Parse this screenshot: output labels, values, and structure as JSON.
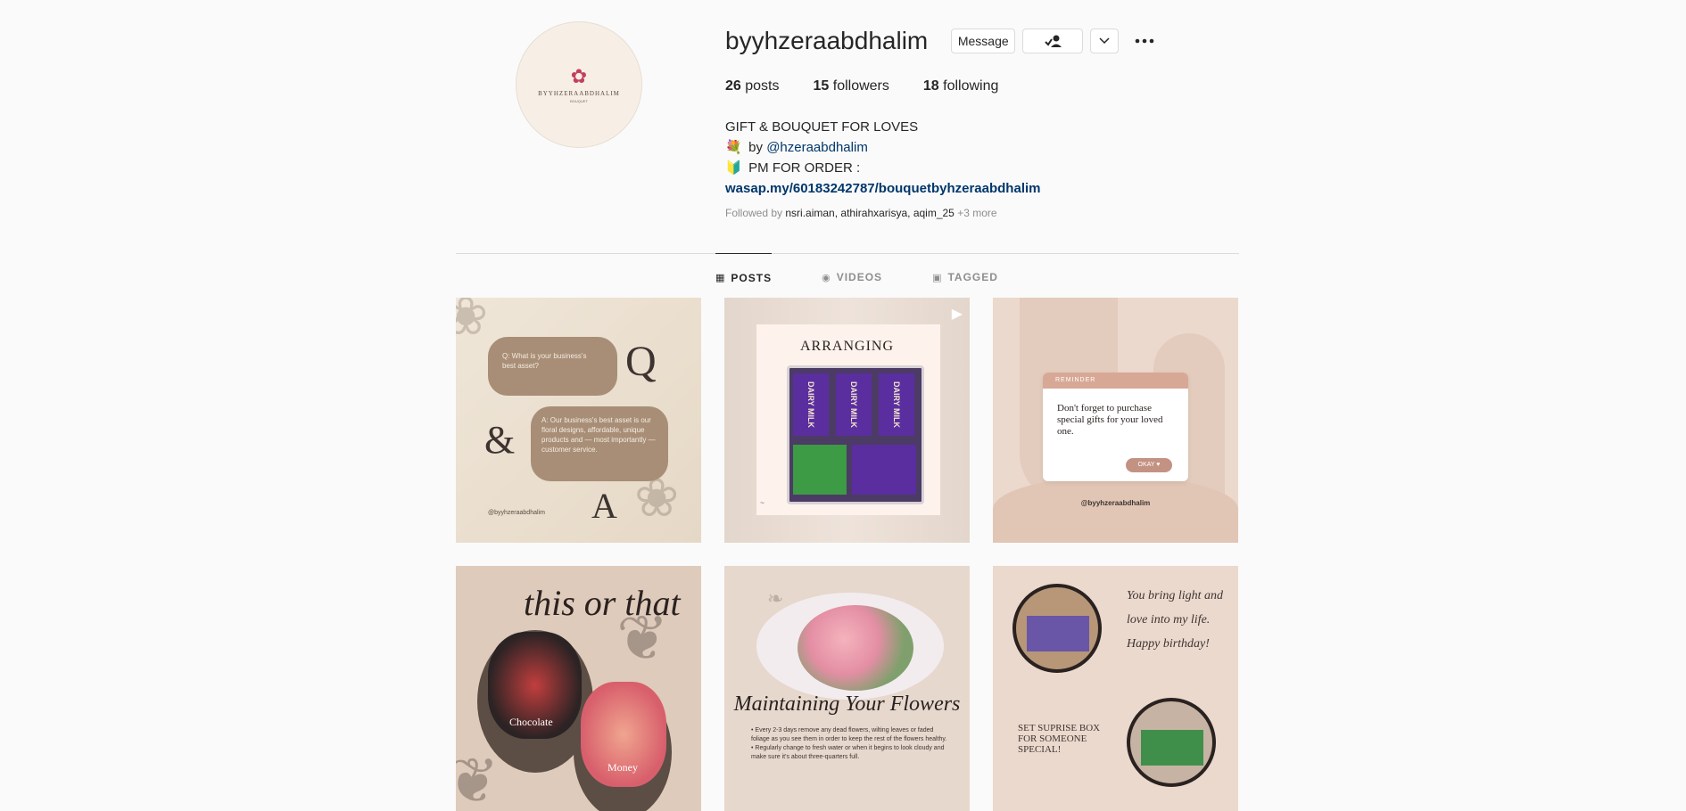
{
  "profile": {
    "username": "byyhzeraabdhalim",
    "avatar_name": "BYYHZERAABDHALIM",
    "avatar_sub": "BOUQUET",
    "buttons": {
      "message": "Message"
    },
    "stats": {
      "posts_count": "26",
      "posts_label": "posts",
      "followers_count": "15",
      "followers_label": "followers",
      "following_count": "18",
      "following_label": "following"
    },
    "bio": {
      "title": "GIFT & BOUQUET FOR LOVES",
      "line1_prefix": "by",
      "line1_mention": "@hzeraabdhalim",
      "line2": "PM FOR ORDER :",
      "link": "wasap.my/60183242787/bouquetbyhzeraabdhalim"
    },
    "followed_by": {
      "prefix": "Followed by",
      "names": [
        "nsri.aiman",
        "athirahxarisya",
        "aqim_25"
      ],
      "more": "+3 more"
    }
  },
  "tabs": [
    {
      "label": "POSTS",
      "icon": "grid-icon",
      "active": true
    },
    {
      "label": "VIDEOS",
      "icon": "play-circle-icon",
      "active": false
    },
    {
      "label": "TAGGED",
      "icon": "tag-icon",
      "active": false
    }
  ],
  "posts": {
    "p1": {
      "question": "Q: What is your business's best asset?",
      "answer": "A: Our business's best asset is our floral designs, affordable, unique products and — most importantly — customer service.",
      "q": "Q",
      "amp": "&",
      "a": "A",
      "handle": "@byyhzeraabdhalim"
    },
    "p2": {
      "title": "ARRANGING",
      "bar1": "DAIRY MILK",
      "bar2": "DAIRY MILK",
      "bar3": "DAIRY MILK"
    },
    "p3": {
      "head": "REMINDER",
      "text": "Don't forget to purchase special gifts for your loved one.",
      "okay": "OKAY",
      "handle": "@byyhzeraabdhalim"
    },
    "p4": {
      "title": "this or that",
      "label1": "Chocolate",
      "label2": "Money"
    },
    "p5": {
      "title": "Maintaining Your Flowers",
      "item1": "Every 2-3 days remove any dead flowers, wilting leaves or faded foliage as you see them in order to keep the rest of the flowers healthy.",
      "item2": "Regularly change to fresh water or when it begins to look cloudy and make sure it's about three-quarters full."
    },
    "p6": {
      "quote": "You bring light and love into my life. Happy birthday!",
      "set": "SET SUPRISE BOX FOR SOMEONE SPECIAL!"
    }
  }
}
